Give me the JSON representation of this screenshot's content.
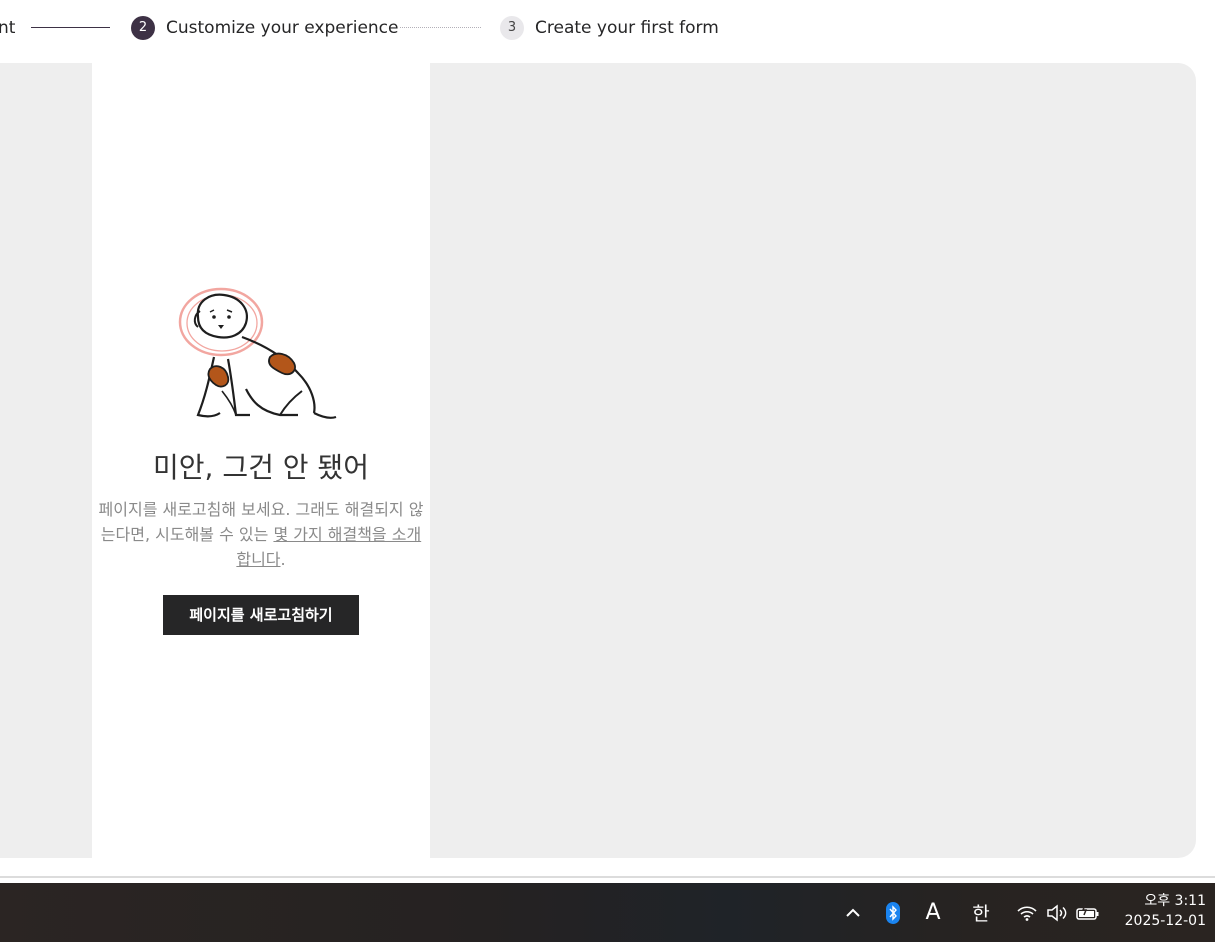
{
  "stepper": {
    "step1_partial_label": "nt",
    "step2": {
      "number": "2",
      "label": "Customize your experience"
    },
    "step3": {
      "number": "3",
      "label": "Create your first form"
    },
    "active_color": "#3d3145"
  },
  "error": {
    "title": "미안, 그건 안 됐어",
    "body_text": "페이지를 새로고침해 보세요. 그래도 해결되지 않는다면, 시도해볼 수 있는 ",
    "link_text": "몇 가지 해결책을 소개합니다",
    "body_end": ".",
    "refresh_button": "페이지를 새로고침하기",
    "illustration": "dog-with-cone-illustration"
  },
  "taskbar": {
    "tray_icons": [
      "chevron-up-icon",
      "bluetooth-icon",
      "font-icon",
      "ime-icon",
      "wifi-icon",
      "volume-icon",
      "battery-icon"
    ],
    "ime_label": "한",
    "font_label": "A",
    "time": "오후 3:11",
    "date": "2025-12-01"
  }
}
